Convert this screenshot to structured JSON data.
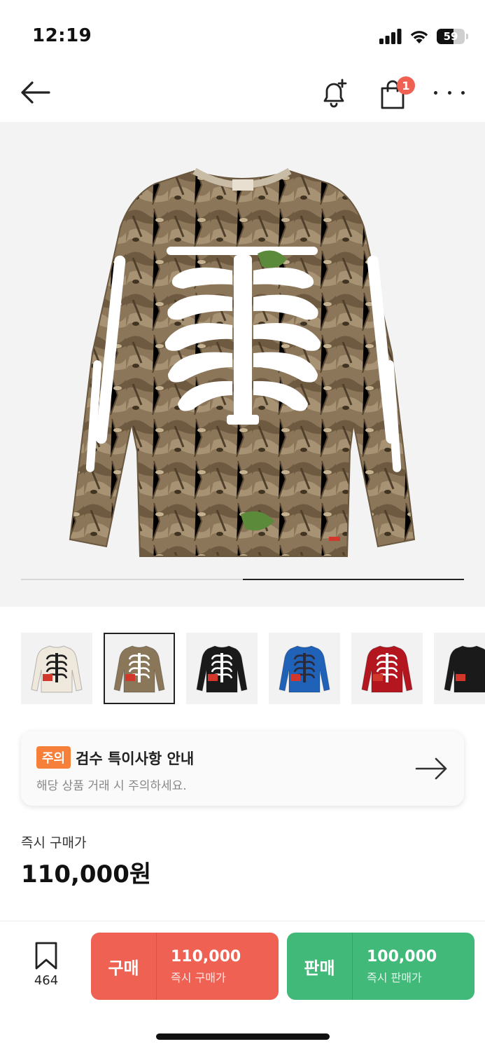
{
  "status_bar": {
    "time": "12:19",
    "battery": "59",
    "battery_level_percent": 59,
    "icons": [
      "signal-icon",
      "wifi-icon",
      "battery-icon"
    ]
  },
  "header": {
    "back_icon": "arrow-left-icon",
    "bell_icon": "bell-plus-icon",
    "bag_icon": "shopping-bag-icon",
    "bag_badge": "1",
    "more_icon": "more-horizontal-icon"
  },
  "gallery": {
    "image_description_icon": "product-longsleeve-shirt-image",
    "progress_fraction": 0.5,
    "thumbnails": [
      {
        "name": "thumbnail-cream",
        "color": "#efe8dc",
        "bone": "#1c1c1c",
        "selected": false
      },
      {
        "name": "thumbnail-camo",
        "color": "#8a7658",
        "bone": "#ffffff",
        "selected": true
      },
      {
        "name": "thumbnail-black",
        "color": "#1a1a1a",
        "bone": "#ffffff",
        "selected": false
      },
      {
        "name": "thumbnail-blue",
        "color": "#1f62b8",
        "bone": "#2a2a3a",
        "selected": false
      },
      {
        "name": "thumbnail-red",
        "color": "#b3161f",
        "bone": "#ffffff",
        "selected": false
      },
      {
        "name": "thumbnail-black-2",
        "color": "#1a1a1a",
        "bone": "#1a1a1a",
        "selected": false
      }
    ]
  },
  "notice": {
    "badge": "주의",
    "title": "검수 특이사항 안내",
    "subtitle": "해당 상품 거래 시 주의하세요.",
    "arrow_icon": "arrow-right-icon"
  },
  "price": {
    "label": "즉시 구매가",
    "value": "110,000원"
  },
  "bottom_bar": {
    "bookmark_icon": "bookmark-icon",
    "bookmark_count": "464",
    "buy": {
      "label": "구매",
      "price": "110,000",
      "caption": "즉시 구매가"
    },
    "sell": {
      "label": "판매",
      "price": "100,000",
      "caption": "즉시 판매가"
    }
  },
  "colors": {
    "buy": "#ef6253",
    "sell": "#41b979",
    "notice_badge": "#f6803a"
  }
}
